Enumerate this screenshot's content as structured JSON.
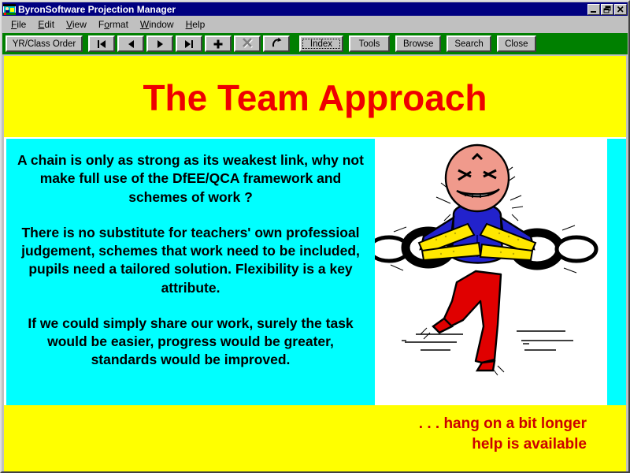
{
  "window": {
    "title": "ByronSoftware Projection Manager",
    "icon": "app-icon",
    "caption_buttons": [
      {
        "name": "minimize-button",
        "label": "_"
      },
      {
        "name": "restore-button",
        "label": "❐"
      },
      {
        "name": "close-button",
        "label": "✕"
      }
    ]
  },
  "menu": {
    "items": [
      {
        "label": "File",
        "accel": "F"
      },
      {
        "label": "Edit",
        "accel": "E"
      },
      {
        "label": "View",
        "accel": "V"
      },
      {
        "label": "Format",
        "accel": "o"
      },
      {
        "label": "Window",
        "accel": "W"
      },
      {
        "label": "Help",
        "accel": "H"
      }
    ]
  },
  "toolbar": {
    "order_button": "YR/Class Order",
    "nav": [
      {
        "name": "first-record-button",
        "icon": "first-record-icon"
      },
      {
        "name": "previous-record-button",
        "icon": "previous-record-icon"
      },
      {
        "name": "next-record-button",
        "icon": "next-record-icon"
      },
      {
        "name": "last-record-button",
        "icon": "last-record-icon"
      },
      {
        "name": "add-record-button",
        "icon": "plus-icon"
      },
      {
        "name": "delete-record-button",
        "icon": "cross-icon",
        "disabled": true
      },
      {
        "name": "refresh-button",
        "icon": "refresh-arrow-icon"
      }
    ],
    "buttons": [
      {
        "name": "index-button",
        "label": "Index",
        "accel": "I",
        "focused": true
      },
      {
        "name": "tools-button",
        "label": "Tools",
        "accel": "T",
        "focused": false
      },
      {
        "name": "browse-button",
        "label": "Browse",
        "accel": "B",
        "focused": false
      },
      {
        "name": "search-button",
        "label": "Search",
        "accel": "S",
        "focused": false
      },
      {
        "name": "close-button",
        "label": "Close",
        "accel": "C",
        "focused": false
      }
    ]
  },
  "slide": {
    "title": "The Team Approach",
    "paragraphs": [
      "A chain is only as strong as its weakest link, why not make full use of the DfEE/QCA framework and schemes of work ?",
      "There is no substitute for teachers' own professioal judgement, schemes that work need to be included, pupils need a tailored solution. Flexibility is a key attribute.",
      "If we could simply share our work, surely the task would be easier, progress would be greater, standards would be improved."
    ],
    "caption_line1": ". . . hang on a bit longer",
    "caption_line2": "help is available",
    "illustration": "straining-figure-breaking-chain-clipart"
  },
  "colors": {
    "title_band": "#ffff00",
    "title_text": "#ee0000",
    "text_panel": "#00ffff",
    "body_text": "#000000",
    "caption_text": "#cc0000",
    "toolbar_strip": "#008000",
    "titlebar": "#000080"
  }
}
